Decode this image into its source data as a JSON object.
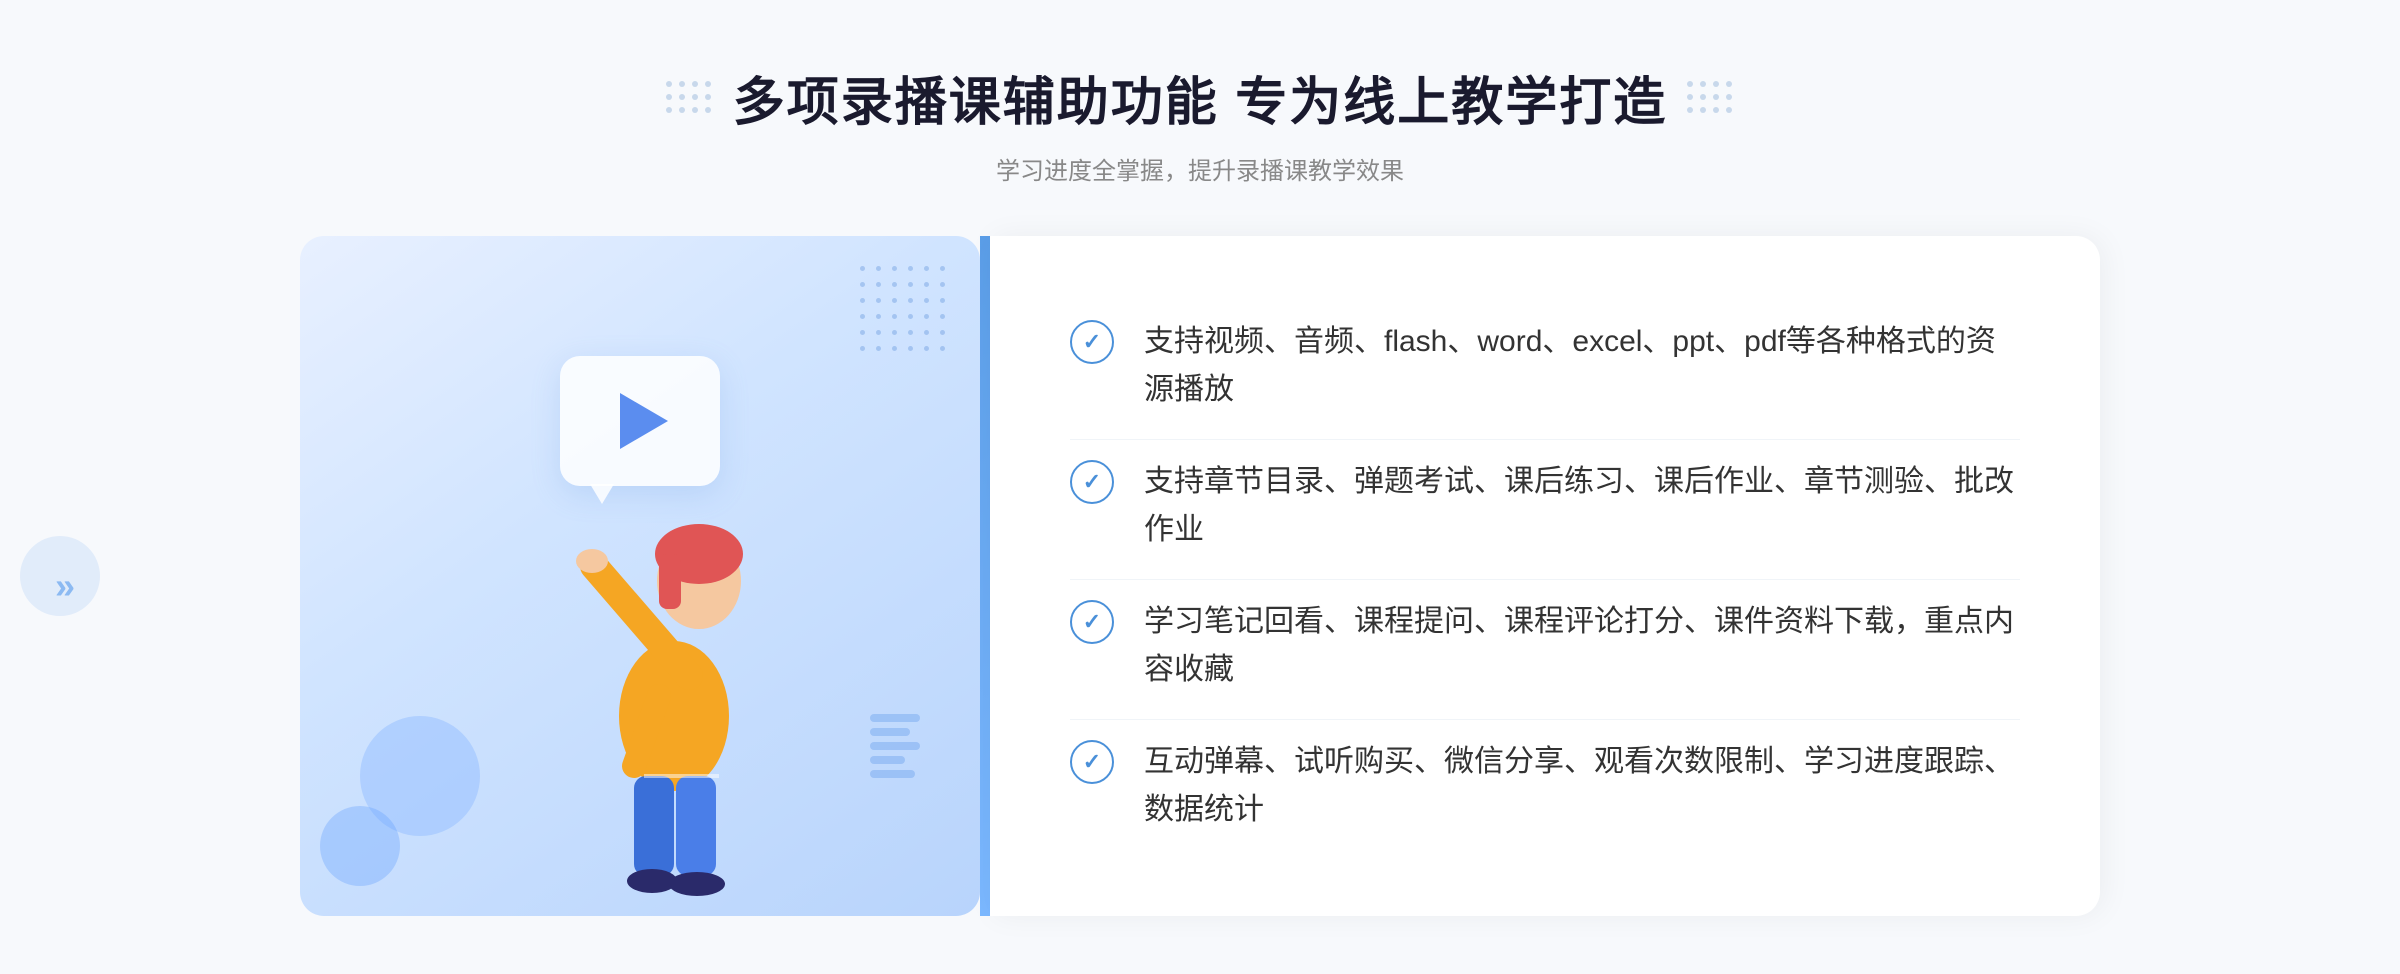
{
  "header": {
    "title": "多项录播课辅助功能 专为线上教学打造",
    "subtitle": "学习进度全掌握，提升录播课教学效果"
  },
  "features": [
    {
      "id": 1,
      "text": "支持视频、音频、flash、word、excel、ppt、pdf等各种格式的资源播放"
    },
    {
      "id": 2,
      "text": "支持章节目录、弹题考试、课后练习、课后作业、章节测验、批改作业"
    },
    {
      "id": 3,
      "text": "学习笔记回看、课程提问、课程评论打分、课件资料下载，重点内容收藏"
    },
    {
      "id": 4,
      "text": "互动弹幕、试听购买、微信分享、观看次数限制、学习进度跟踪、数据统计"
    }
  ],
  "decorations": {
    "chevron_left": "«",
    "chevron_right": "»",
    "check_symbol": "✓"
  }
}
